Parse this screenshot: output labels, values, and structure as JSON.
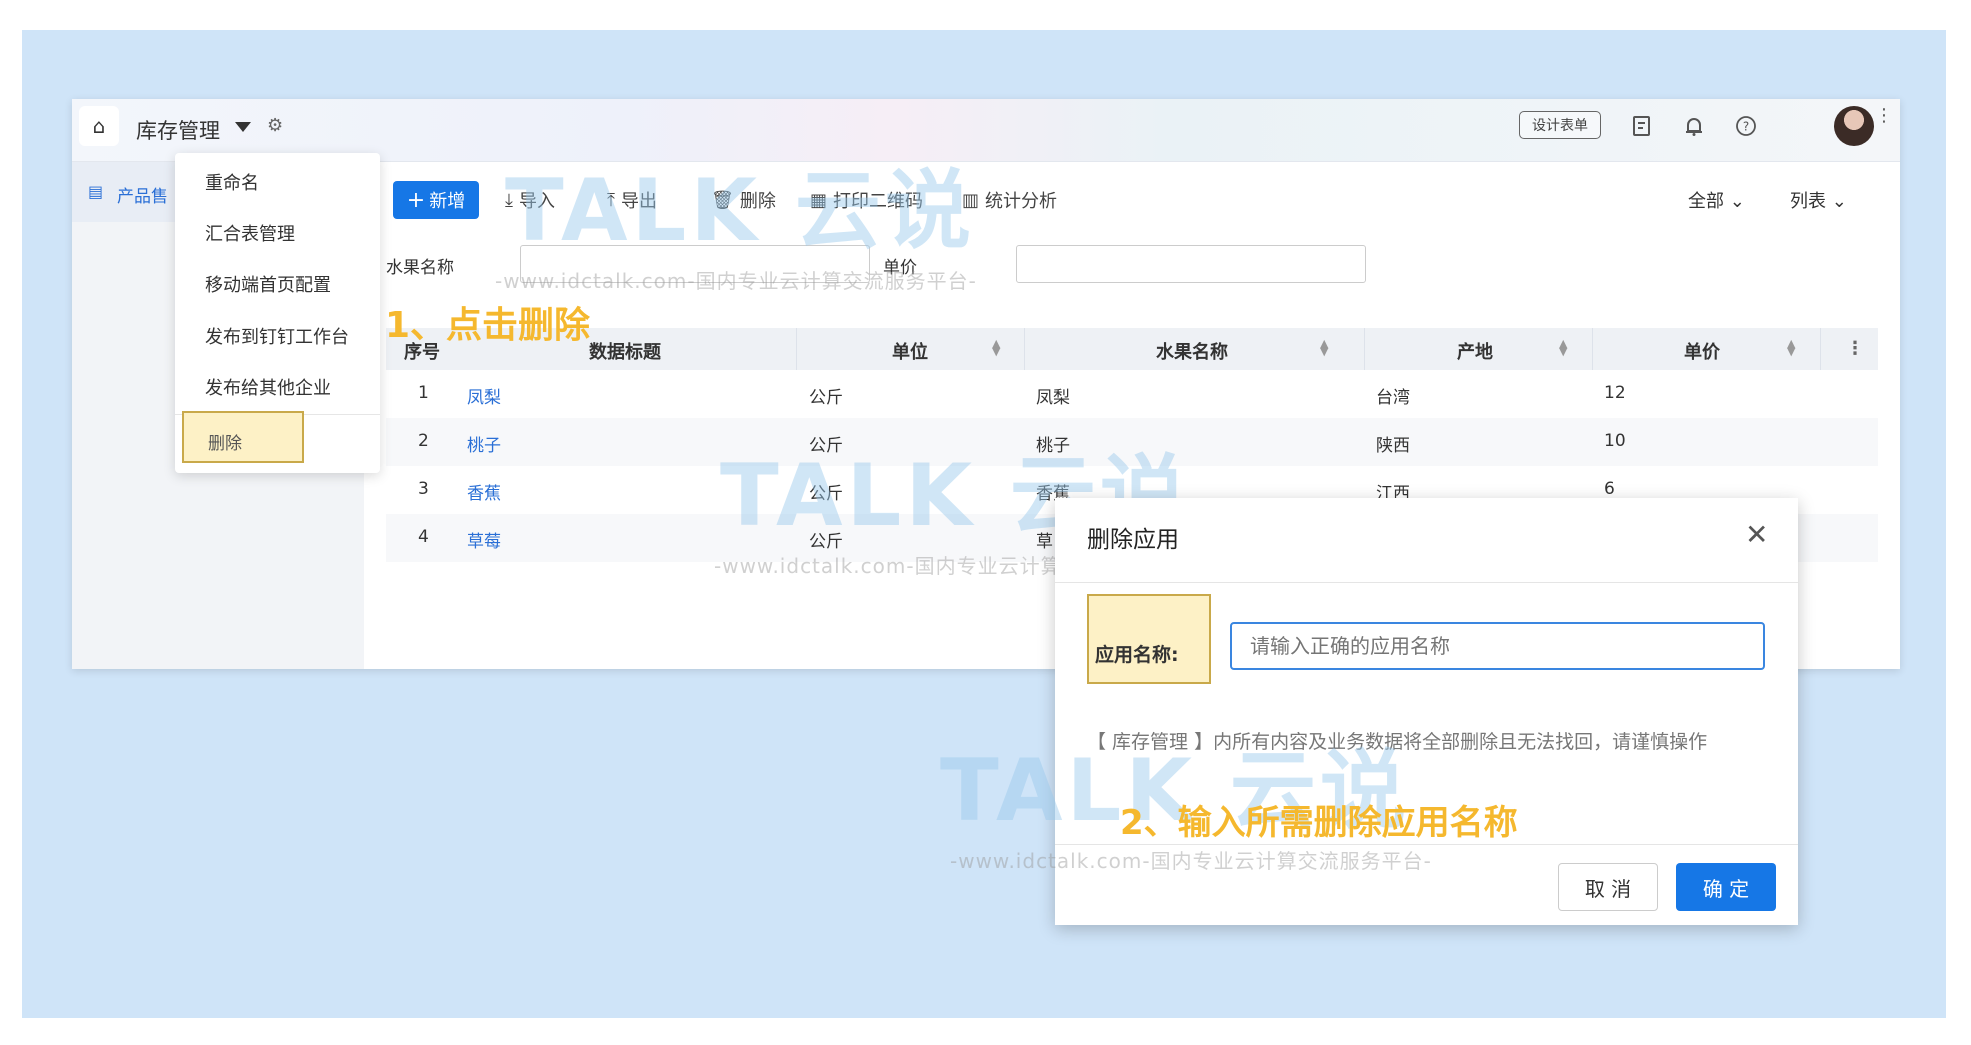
{
  "app": {
    "title": "库存管理",
    "design_button": "设计表单",
    "sidebar_item": "产品售",
    "toolbar": {
      "add": "新增",
      "import": "导入",
      "export": "导出",
      "delete": "删除",
      "print_qr": "打印二维码",
      "stats": "统计分析",
      "scope": "全部",
      "view": "列表"
    },
    "filters": [
      {
        "label": "水果名称",
        "value": ""
      },
      {
        "label": "单价",
        "value": ""
      }
    ],
    "table": {
      "columns": [
        "序号",
        "数据标题",
        "单位",
        "水果名称",
        "产地",
        "单价"
      ],
      "rows": [
        [
          "1",
          "凤梨",
          "公斤",
          "凤梨",
          "台湾",
          "12"
        ],
        [
          "2",
          "桃子",
          "公斤",
          "桃子",
          "陕西",
          "10"
        ],
        [
          "3",
          "香蕉",
          "公斤",
          "香蕉",
          "江西",
          "6"
        ],
        [
          "4",
          "草莓",
          "公斤",
          "草",
          "",
          ""
        ]
      ]
    }
  },
  "menu": {
    "items": [
      "重命名",
      "汇合表管理",
      "移动端首页配置",
      "发布到钉钉工作台",
      "发布给其他企业"
    ],
    "delete": "删除"
  },
  "annotations": {
    "step1": "1、点击删除",
    "step2": "2、输入所需删除应用名称"
  },
  "modal": {
    "title": "删除应用",
    "name_label": "应用名称:",
    "name_placeholder": "请输入正确的应用名称",
    "warning": "【 库存管理 】内所有内容及业务数据将全部删除且无法找回，请谨慎操作",
    "cancel": "取 消",
    "confirm": "确 定"
  },
  "watermark": {
    "logo": "TALK 云说",
    "url": "-www.idctalk.com-国内专业云计算交流服务平台-"
  },
  "colors": {
    "primary": "#1677e6",
    "highlight": "#fdf1c6",
    "annotation": "#f5b82e",
    "background": "#cfe4f8"
  }
}
